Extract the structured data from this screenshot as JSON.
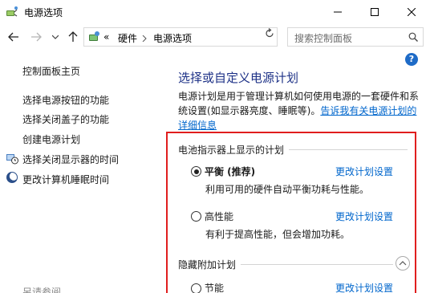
{
  "window": {
    "title": "电源选项",
    "icons": {
      "app": "power-options-icon",
      "minimize": "minimize-icon",
      "maximize": "maximize-icon",
      "close": "close-icon"
    }
  },
  "navbar": {
    "breadcrumb_prefix": "«",
    "crumbs": [
      "硬件",
      "电源选项"
    ],
    "search_placeholder": "搜索控制面板"
  },
  "sidebar": {
    "home": "控制面板主页",
    "items": [
      {
        "label": "选择电源按钮的功能"
      },
      {
        "label": "选择关闭盖子的功能"
      },
      {
        "label": "创建电源计划"
      },
      {
        "label": "选择关闭显示器的时间",
        "icon": "monitor-clock-icon"
      },
      {
        "label": "更改计算机睡眠时间",
        "icon": "moon-icon"
      }
    ],
    "see_also": "另请参阅"
  },
  "main": {
    "help_label": "?",
    "title": "选择或自定义电源计划",
    "description": "电源计划是用于管理计算机如何使用电源的一套硬件和系统设置(如显示器亮度、睡眠等)。",
    "description_link": "告诉我有关电源计划的详细信息",
    "battery_section": "电池指示器上显示的计划",
    "hidden_section": "隐藏附加计划",
    "plans": [
      {
        "name": "平衡 (推荐)",
        "desc": "利用可用的硬件自动平衡功耗与性能。",
        "link": "更改计划设置",
        "selected": true
      },
      {
        "name": "高性能",
        "desc": "有利于提高性能，但会增加功耗。",
        "link": "更改计划设置",
        "selected": false
      },
      {
        "name": "节能",
        "desc": "",
        "link": "更改计划设置",
        "selected": false
      }
    ]
  },
  "colors": {
    "accent_link": "#0066cc",
    "title_blue": "#1e3287",
    "highlight_box": "#e01e1e"
  }
}
